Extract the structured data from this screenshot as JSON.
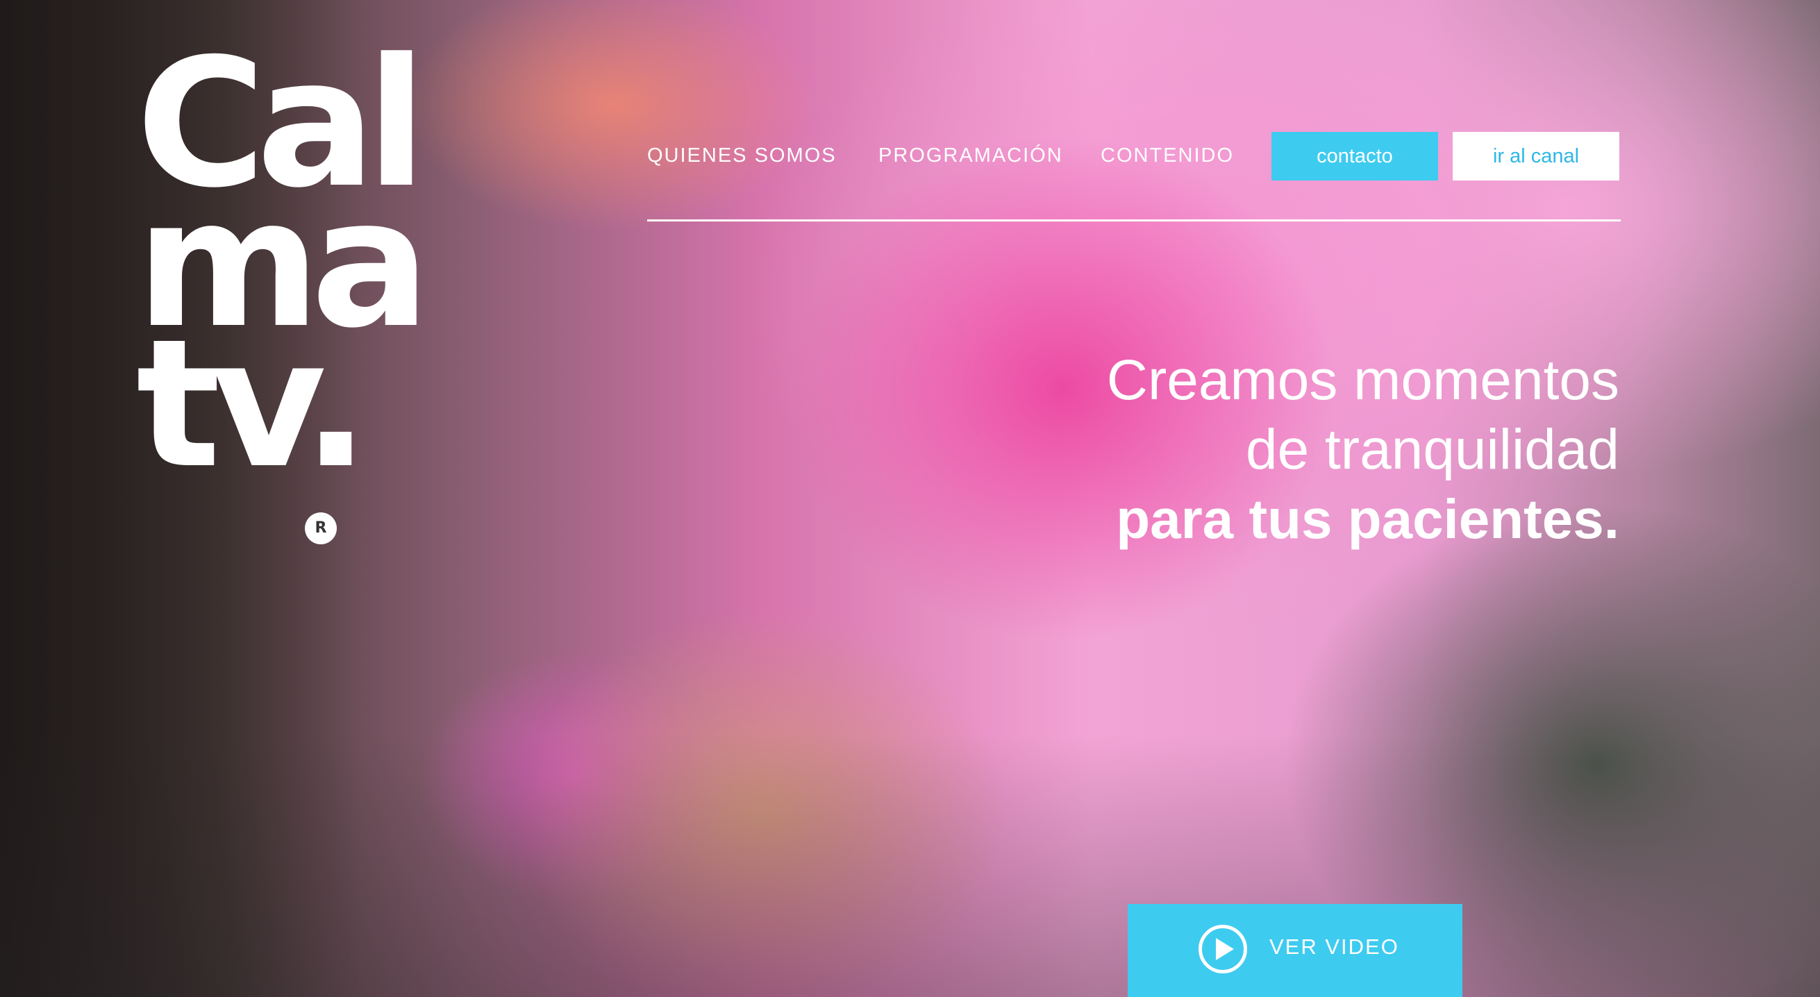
{
  "brand": {
    "logo_lines": [
      "Cal",
      "ma",
      "tv."
    ],
    "registered_mark": "R"
  },
  "nav": {
    "links": [
      {
        "label": "QUIENES SOMOS"
      },
      {
        "label": "PROGRAMACIÓN"
      },
      {
        "label": "CONTENIDO"
      }
    ],
    "contact_label": "contacto",
    "channel_label": "ir al canal"
  },
  "hero": {
    "line1": "Creamos momentos",
    "line2": "de tranquilidad",
    "line3": "para tus pacientes."
  },
  "video": {
    "label": "VER VIDEO",
    "icon": "play-circle-icon"
  },
  "colors": {
    "accent": "#3ecbf0",
    "text": "#ffffff",
    "background_pink": "#e75fae"
  }
}
